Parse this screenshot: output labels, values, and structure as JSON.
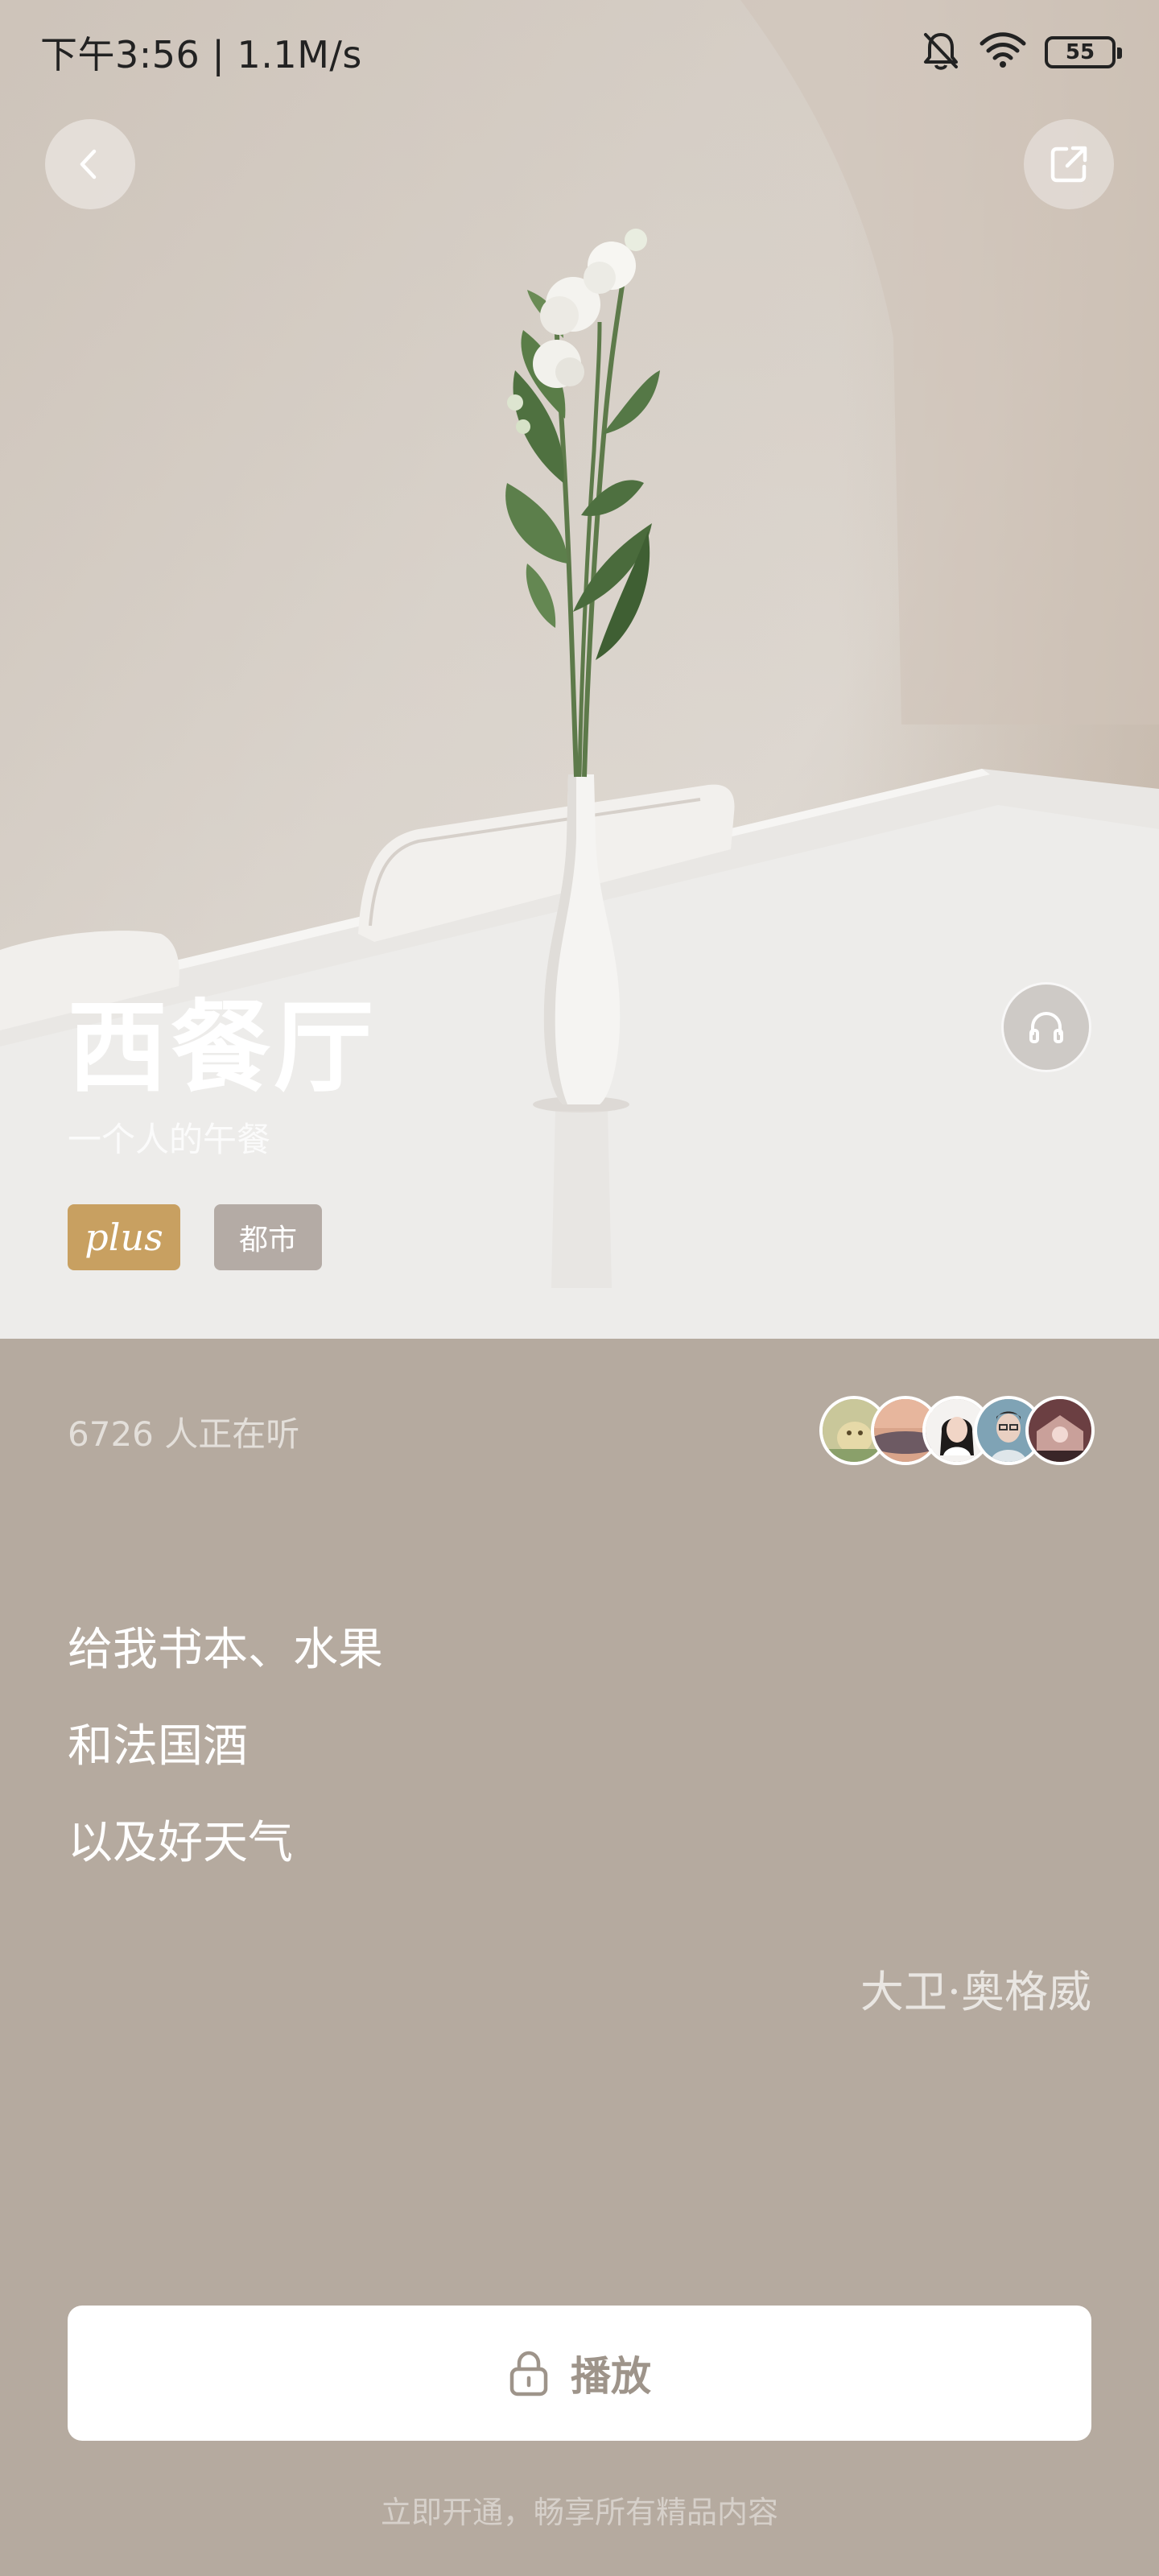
{
  "status_bar": {
    "time_speed": "下午3:56 | 1.1M/s",
    "battery": "55",
    "icons": [
      "mute-bell-icon",
      "wifi-icon",
      "battery-icon"
    ]
  },
  "header": {
    "back_icon": "chevron-left-icon",
    "share_icon": "share-icon"
  },
  "hero": {
    "title": "西餐厅",
    "subtitle": "一个人的午餐",
    "listen_icon": "headphones-icon",
    "tags": {
      "plus": "plus",
      "category": "都市"
    }
  },
  "listeners": {
    "text": "6726 人正在听",
    "avatars": [
      "cat",
      "sunset",
      "girl",
      "man-glasses",
      "pink-scene"
    ]
  },
  "poem": {
    "lines": [
      "给我书本、水果",
      "和法国酒",
      "以及好天气"
    ],
    "author": "大卫·奥格威"
  },
  "play": {
    "label": "播放",
    "icon": "lock-icon"
  },
  "promo": "立即开通，畅享所有精品内容",
  "colors": {
    "body_bg": "#b5aa9f",
    "plus_tag": "#c8a061",
    "play_text": "#9e948a"
  }
}
